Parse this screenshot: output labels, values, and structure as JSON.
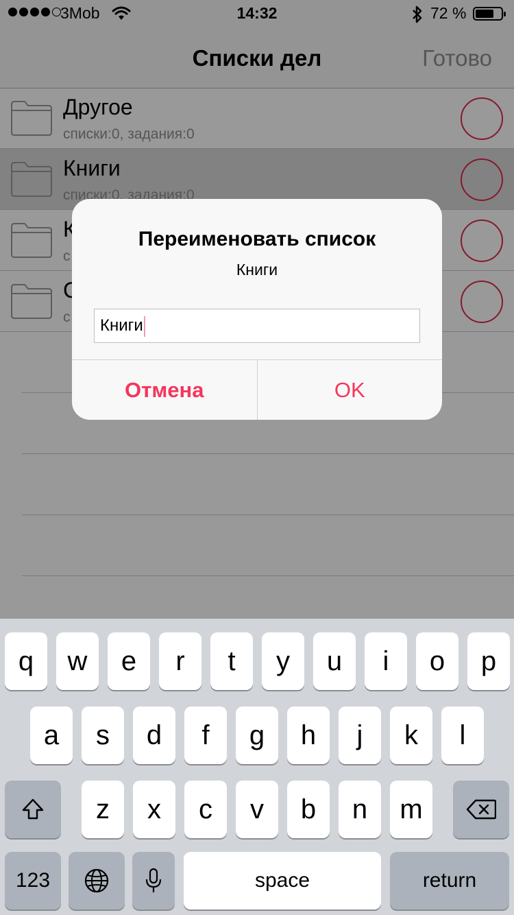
{
  "status_bar": {
    "carrier": "3Mob",
    "time": "14:32",
    "battery_percent": "72 %",
    "battery_level": 0.72,
    "signal_bars_filled": 4,
    "signal_bars_total": 5
  },
  "nav": {
    "title": "Списки дел",
    "done_label": "Готово"
  },
  "list": {
    "rows": [
      {
        "title": "Другое",
        "subtitle": "списки:0, задания:0"
      },
      {
        "title": "Книги",
        "subtitle": "списки:0, задания:0"
      },
      {
        "title": "К",
        "subtitle": "с"
      },
      {
        "title": "С",
        "subtitle": "с"
      }
    ]
  },
  "alert": {
    "title": "Переименовать список",
    "message": "Книги",
    "input_value": "Книги",
    "cancel_label": "Отмена",
    "ok_label": "OK"
  },
  "keyboard": {
    "row1": [
      "q",
      "w",
      "e",
      "r",
      "t",
      "y",
      "u",
      "i",
      "o",
      "p"
    ],
    "row2": [
      "a",
      "s",
      "d",
      "f",
      "g",
      "h",
      "j",
      "k",
      "l"
    ],
    "row3": [
      "z",
      "x",
      "c",
      "v",
      "b",
      "n",
      "m"
    ],
    "numbers_label": "123",
    "space_label": "space",
    "return_label": "return"
  },
  "colors": {
    "accent": "#f5365c",
    "checkbox": "#e0294a"
  }
}
